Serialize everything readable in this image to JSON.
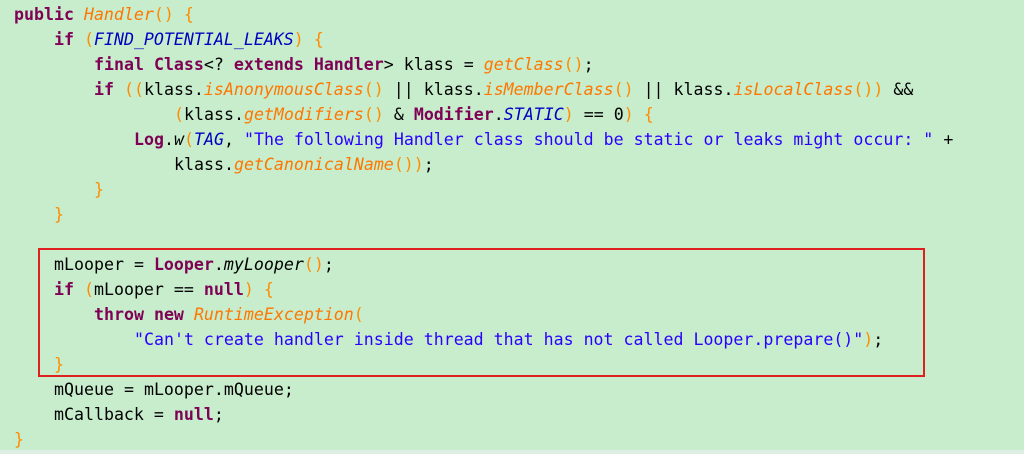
{
  "code": {
    "l1": {
      "kw": "public",
      "m": "Handler",
      "p": "()",
      "b": "{"
    },
    "l2": {
      "kw": "if",
      "p1": "(",
      "c": "FIND_POTENTIAL_LEAKS",
      "p2": ")",
      "b": "{"
    },
    "l3": {
      "kw1": "final",
      "t": "Class",
      "g1": "<?",
      "kw2": "extends",
      "t2": "Handler",
      "g2": ">",
      "v": "klass",
      "eq": "=",
      "m": "getClass",
      "p": "()",
      "sc": ";"
    },
    "l4": {
      "kw": "if",
      "p1": "((",
      "v1": "klass",
      "d1": ".",
      "m1": "isAnonymousClass",
      "p2": "()",
      "or1": "||",
      "v2": "klass",
      "d2": ".",
      "m2": "isMemberClass",
      "p3": "()",
      "or2": "||",
      "v3": "klass",
      "d3": ".",
      "m3": "isLocalClass",
      "p4": "())",
      "and": "&&"
    },
    "l5": {
      "p1": "(",
      "v": "klass",
      "d": ".",
      "m": "getModifiers",
      "p2": "()",
      "amp": "&",
      "t": "Modifier",
      "d2": ".",
      "c": "STATIC",
      "p3": ")",
      "eq": "==",
      "n": "0",
      "p4": ")",
      "b": "{"
    },
    "l6": {
      "t": "Log",
      "d": ".",
      "m": "w",
      "p": "(",
      "c": "TAG",
      "cm": ",",
      "s": "\"The following Handler class should be static or leaks might occur: \"",
      "plus": "+"
    },
    "l7": {
      "v": "klass",
      "d": ".",
      "m": "getCanonicalName",
      "p": "())",
      "sc": ";"
    },
    "l8": {
      "b": "}"
    },
    "l9": {
      "b": "}"
    },
    "l11": {
      "v": "mLooper",
      "eq": "=",
      "t": "Looper",
      "d": ".",
      "m": "myLooper",
      "p": "()",
      "sc": ";"
    },
    "l12": {
      "kw": "if",
      "p1": "(",
      "v": "mLooper",
      "eq": "==",
      "nul": "null",
      "p2": ")",
      "b": "{"
    },
    "l13": {
      "kw1": "throw",
      "kw2": "new",
      "m": "RuntimeException",
      "p": "("
    },
    "l14": {
      "s": "\"Can't create handler inside thread that has not called Looper.prepare()\"",
      "p": ")",
      "sc": ";"
    },
    "l15": {
      "b": "}"
    },
    "l16": {
      "v1": "mQueue",
      "eq": "=",
      "v2": "mLooper",
      "d": ".",
      "v3": "mQueue",
      "sc": ";"
    },
    "l17": {
      "v": "mCallback",
      "eq": "=",
      "nul": "null",
      "sc": ";"
    },
    "l18": {
      "b": "}"
    }
  },
  "colors": {
    "background": "#c7edcc",
    "keyword": "#7f0055",
    "method": "#ff7700",
    "constant": "#0000c0",
    "string": "#2a00ff",
    "bracket": "#ff8c00",
    "highlight_border": "#e02020"
  }
}
